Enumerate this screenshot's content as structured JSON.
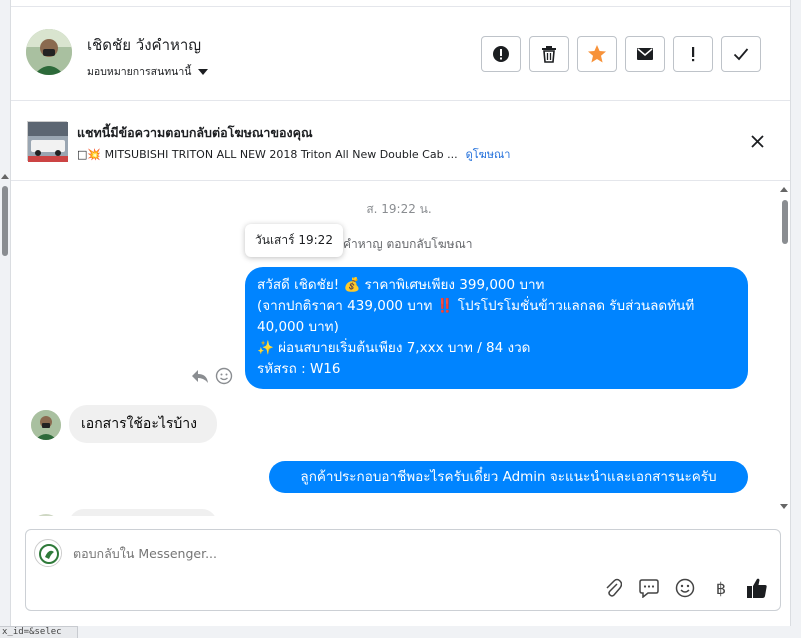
{
  "header": {
    "contact_name": "เชิดชัย วังคำหาญ",
    "assign_label": "มอบหมายการสนทนานี้",
    "actions": [
      "spam-alert",
      "delete",
      "star",
      "mark-unread",
      "important",
      "done"
    ],
    "star_color": "#f7923a"
  },
  "ad_banner": {
    "title": "แชทนี้มีข้อความตอบกลับต่อโฆษณาของคุณ",
    "ad_text": "□💥 MITSUBISHI TRITON ALL NEW 2018 Triton All New Double Cab ...",
    "link_label": "ดูโฆษณา"
  },
  "messages": {
    "timestamp": "ส. 19:22 น.",
    "tooltip": "วันเสาร์ 19:22",
    "reply_meta": "คำหาญ ตอบกลับโฆษณา",
    "out_1_lines": [
      "สวัสดี เชิดชัย! 💰 ราคาพิเศษเพียง 399,000 บาท",
      "(จากปกติราคา 439,000 บาท ‼️ โปรโปรโมชั่นข้าวแลกลด รับส่วนลดทันที",
      "40,000 บาท)",
      "✨ ผ่อนสบายเริ่มต้นเพียง 7,xxx บาท / 84 งวด",
      " รหัสรถ : W16"
    ],
    "in_1": "เอกสารใช้อะไรบ้าง",
    "out_2": "ลูกค้าประกอบอาชีพอะไรครับเดี๋ยว Admin จะแนะนำและเอกสารนะครับ",
    "accent_color": "#0084ff"
  },
  "composer": {
    "placeholder": "ตอบกลับใน Messenger...",
    "tools": [
      "attach-icon",
      "saved-reply-icon",
      "emoji-icon",
      "payment-icon",
      "like-icon"
    ],
    "currency_glyph": "฿"
  },
  "status_url": "x_id=&selec"
}
